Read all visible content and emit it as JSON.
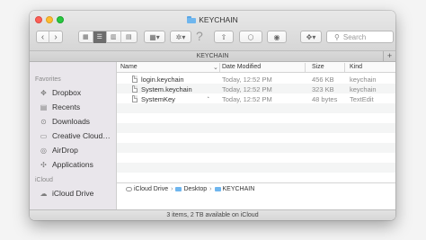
{
  "window": {
    "title": "KEYCHAIN"
  },
  "toolbar": {
    "back": "‹",
    "forward": "›",
    "view_icons": "▦",
    "view_list": "☰",
    "view_columns": "▥",
    "view_cover": "▤",
    "arrange": "▦▾",
    "action": "✲▾",
    "help_icon": "?",
    "share_icon": "⇧",
    "tags_icon": "◯",
    "quicklook_icon": "◉",
    "dropbox": "✥▾",
    "search_placeholder": "Search"
  },
  "tabbar": {
    "title": "KEYCHAIN",
    "plus": "+"
  },
  "sidebar": {
    "favorites_header": "Favorites",
    "items": [
      {
        "label": "Dropbox",
        "icon": "dropbox-icon",
        "glyph": "✥"
      },
      {
        "label": "Recents",
        "icon": "recents-icon",
        "glyph": "▤"
      },
      {
        "label": "Downloads",
        "icon": "downloads-icon",
        "glyph": "⊙"
      },
      {
        "label": "Creative Cloud…",
        "icon": "creative-cloud-icon",
        "glyph": "▭"
      },
      {
        "label": "AirDrop",
        "icon": "airdrop-icon",
        "glyph": "◎"
      },
      {
        "label": "Applications",
        "icon": "applications-icon",
        "glyph": "✣"
      }
    ],
    "icloud_header": "iCloud",
    "icloud_items": [
      {
        "label": "iCloud Drive",
        "icon": "icloud-drive-icon",
        "glyph": "☁"
      }
    ]
  },
  "columns": {
    "name": "Name",
    "date": "Date Modified",
    "size": "Size",
    "kind": "Kind",
    "sort_indicator": "⌄"
  },
  "files": [
    {
      "name": "login.keychain",
      "date": "Today, 12:52 PM",
      "size": "456 KB",
      "kind": "keychain",
      "cloud": false
    },
    {
      "name": "System.keychain",
      "date": "Today, 12:52 PM",
      "size": "323 KB",
      "kind": "keychain",
      "cloud": false
    },
    {
      "name": "SystemKey",
      "date": "Today, 12:52 PM",
      "size": "48 bytes",
      "kind": "TextEdit",
      "cloud": true
    }
  ],
  "pathbar": {
    "items": [
      "iCloud Drive",
      "Desktop",
      "KEYCHAIN"
    ],
    "separator": "›"
  },
  "status": {
    "text": "3 items, 2 TB available on iCloud"
  }
}
